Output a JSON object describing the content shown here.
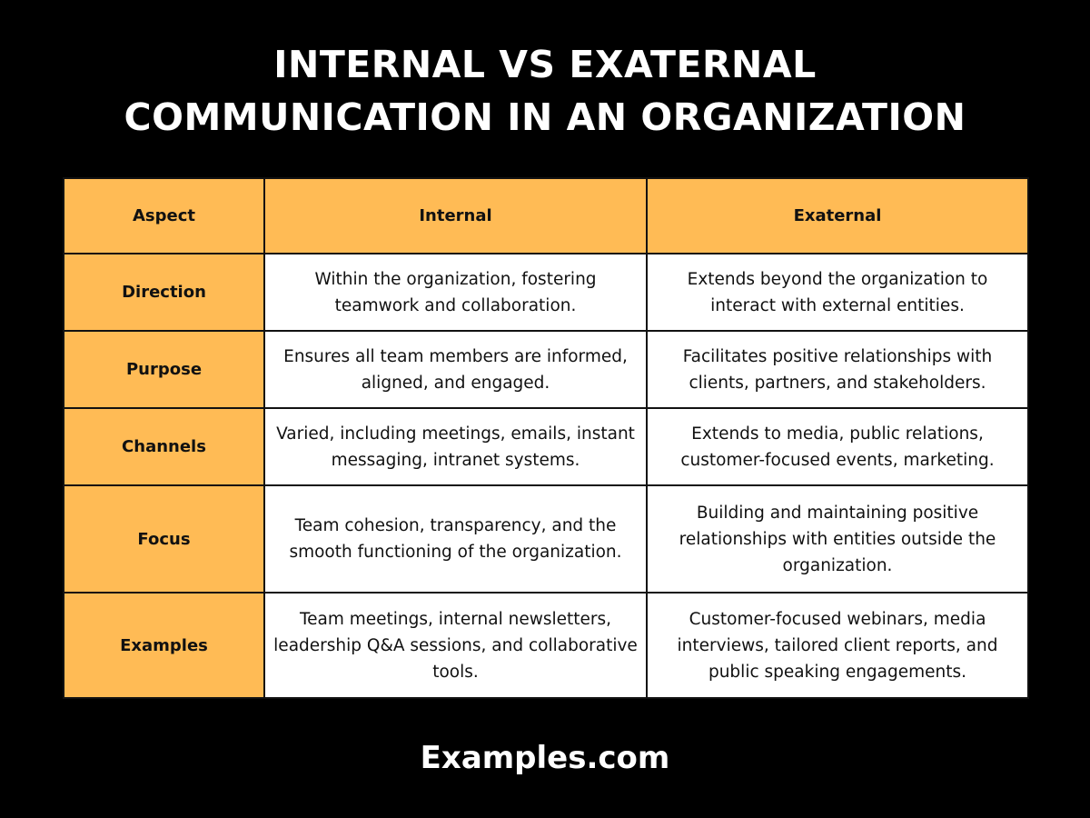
{
  "title": {
    "line1": "INTERNAL VS EXATERNAL",
    "line2": "COMMUNICATION IN AN ORGANIZATION"
  },
  "colors": {
    "background": "#000000",
    "accent": "#FFBB55",
    "cell": "#FFFFFF",
    "border": "#111111",
    "title_text": "#FFFFFF"
  },
  "table": {
    "headers": [
      "Aspect",
      "Internal",
      "Exaternal"
    ],
    "rows": [
      {
        "aspect": "Direction",
        "internal": "Within the organization, fostering teamwork and collaboration.",
        "external": "Extends beyond the organization to interact with external entities."
      },
      {
        "aspect": "Purpose",
        "internal": "Ensures all team members are informed, aligned, and engaged.",
        "external": "Facilitates positive relationships with clients, partners, and stakeholders."
      },
      {
        "aspect": "Channels",
        "internal": "Varied, including meetings, emails, instant messaging, intranet systems.",
        "external": "Extends to media, public relations, customer-focused events, marketing."
      },
      {
        "aspect": "Focus",
        "internal": "Team cohesion, transparency, and the smooth functioning of the organization.",
        "external": "Building and maintaining positive relationships with entities outside the organization."
      },
      {
        "aspect": "Examples",
        "internal": "Team meetings, internal newsletters, leadership Q&A sessions, and collaborative tools.",
        "external": "Customer-focused webinars, media interviews, tailored client reports, and public speaking engagements."
      }
    ]
  },
  "footer": {
    "brand": "Examples.com"
  }
}
